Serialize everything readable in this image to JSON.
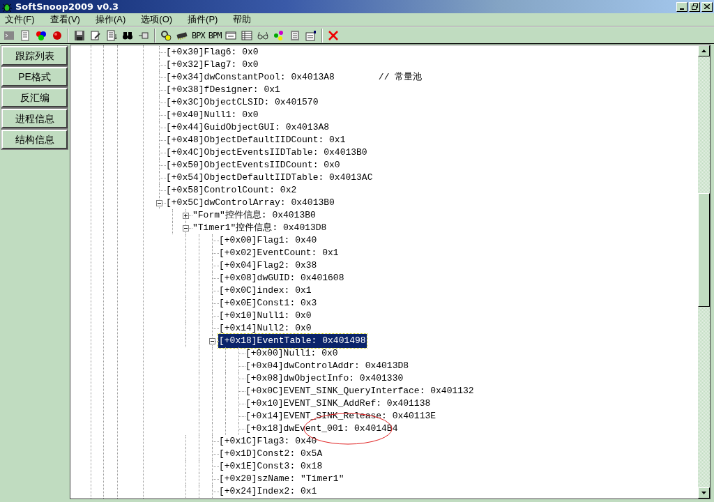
{
  "window": {
    "title": "SoftSnoop2009 v0.3"
  },
  "menu": [
    "文件(F)",
    "查看(V)",
    "操作(A)",
    "选项(O)",
    "插件(P)",
    "帮助"
  ],
  "toolbar_labels": [
    "BPX",
    "BPM"
  ],
  "sidebar": {
    "buttons": [
      "跟踪列表",
      "PE格式",
      "反汇编",
      "进程信息",
      "结构信息"
    ]
  },
  "tree": [
    {
      "text": "[+0x30]Flag6: 0x0",
      "selected": false
    },
    {
      "text": "[+0x32]Flag7: 0x0",
      "selected": false
    },
    {
      "text": "[+0x34]dwConstantPool: 0x4013A8",
      "comment": "// 常量池",
      "selected": false
    },
    {
      "text": "[+0x38]fDesigner: 0x1",
      "selected": false
    },
    {
      "text": "[+0x3C]ObjectCLSID: 0x401570",
      "selected": false
    },
    {
      "text": "[+0x40]Null1: 0x0",
      "selected": false
    },
    {
      "text": "[+0x44]GuidObjectGUI: 0x4013A8",
      "selected": false
    },
    {
      "text": "[+0x48]ObjectDefaultIIDCount: 0x1",
      "selected": false
    },
    {
      "text": "[+0x4C]ObjectEventsIIDTable: 0x4013B0",
      "selected": false
    },
    {
      "text": "[+0x50]ObjectEventsIIDCount: 0x0",
      "selected": false
    },
    {
      "text": "[+0x54]ObjectDefaultIIDTable: 0x4013AC",
      "selected": false
    },
    {
      "text": "[+0x58]ControlCount: 0x2",
      "selected": false
    },
    {
      "text": "[+0x5C]dwControlArray: 0x4013B0",
      "selected": false,
      "expanded": true,
      "children": [
        {
          "text": "\"Form\"控件信息: 0x4013B0",
          "selected": false,
          "expanded": false,
          "collapsed_children": true
        },
        {
          "text": "\"Timer1\"控件信息: 0x4013D8",
          "selected": false,
          "expanded": true,
          "children": [
            {
              "text": "[+0x00]Flag1: 0x40",
              "selected": false
            },
            {
              "text": "[+0x02]EventCount: 0x1",
              "selected": false
            },
            {
              "text": "[+0x04]Flag2: 0x38",
              "selected": false
            },
            {
              "text": "[+0x08]dwGUID: 0x401608",
              "selected": false
            },
            {
              "text": "[+0x0C]index: 0x1",
              "selected": false
            },
            {
              "text": "[+0x0E]Const1: 0x3",
              "selected": false
            },
            {
              "text": "[+0x10]Null1: 0x0",
              "selected": false
            },
            {
              "text": "[+0x14]Null2: 0x0",
              "selected": false
            },
            {
              "text": "[+0x18]EventTable: 0x401498",
              "selected": true,
              "expanded": true,
              "children": [
                {
                  "text": "[+0x00]Null1: 0x0",
                  "selected": false
                },
                {
                  "text": "[+0x04]dwControlAddr: 0x4013D8",
                  "selected": false
                },
                {
                  "text": "[+0x08]dwObjectInfo: 0x401330",
                  "selected": false
                },
                {
                  "text": "[+0x0C]EVENT_SINK_QueryInterface: 0x401132",
                  "selected": false
                },
                {
                  "text": "[+0x10]EVENT_SINK_AddRef: 0x401138",
                  "selected": false
                },
                {
                  "text": "[+0x14]EVENT_SINK_Release: 0x40113E",
                  "selected": false
                },
                {
                  "text": "[+0x18]dwEvent_001: 0x4014B4",
                  "selected": false
                }
              ]
            },
            {
              "text": "[+0x1C]Flag3: 0x40",
              "selected": false
            },
            {
              "text": "[+0x1D]Const2: 0x5A",
              "selected": false
            },
            {
              "text": "[+0x1E]Const3: 0x18",
              "selected": false
            },
            {
              "text": "[+0x20]szName: \"Timer1\"",
              "selected": false
            },
            {
              "text": "[+0x24]Index2: 0x1",
              "selected": false
            }
          ]
        }
      ]
    }
  ]
}
